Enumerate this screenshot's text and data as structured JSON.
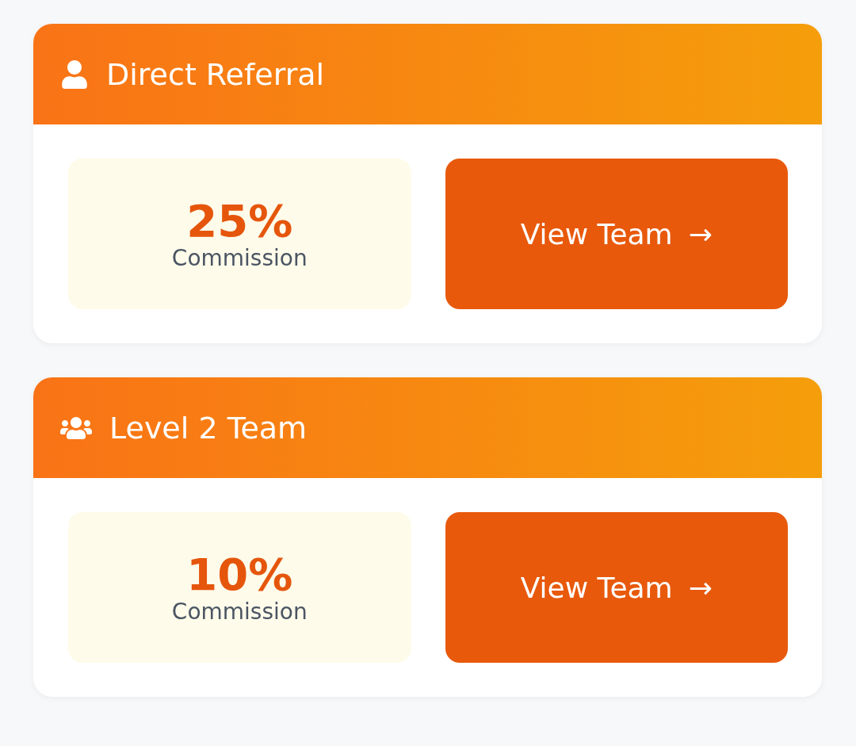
{
  "cards": [
    {
      "kind": "person",
      "title": "Direct Referral",
      "commission": {
        "value": "25%",
        "label": "Commission"
      },
      "button": {
        "label": "View Team",
        "arrow": "→"
      }
    },
    {
      "kind": "group",
      "title": "Level 2 Team",
      "commission": {
        "value": "10%",
        "label": "Commission"
      },
      "button": {
        "label": "View Team",
        "arrow": "→"
      }
    }
  ]
}
